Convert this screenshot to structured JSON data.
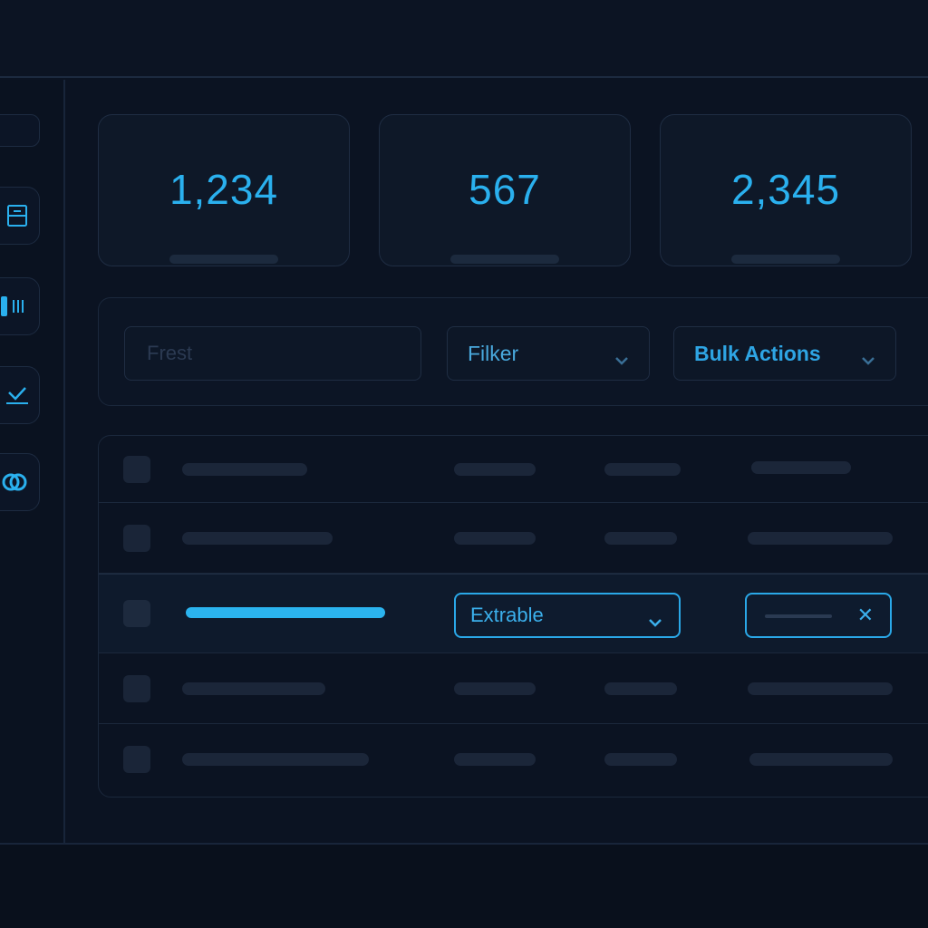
{
  "stats": [
    {
      "value": "1,234"
    },
    {
      "value": "567"
    },
    {
      "value": "2,345"
    }
  ],
  "toolbar": {
    "search_placeholder": "Frest",
    "filter_label": "Filker",
    "bulk_label": "Bulk Actions"
  },
  "table": {
    "selected_row": {
      "select_value": "Extrable"
    }
  },
  "icons": {
    "sidebar": [
      "archive-icon",
      "bars-icon",
      "chart-check-icon",
      "link-icon"
    ],
    "dropdown": "chevron-down-icon",
    "clear": "close-icon"
  },
  "colors": {
    "accent": "#2ab0ee",
    "background": "#0b1322",
    "border": "#1f2d43",
    "placeholder": "#1b2639"
  }
}
